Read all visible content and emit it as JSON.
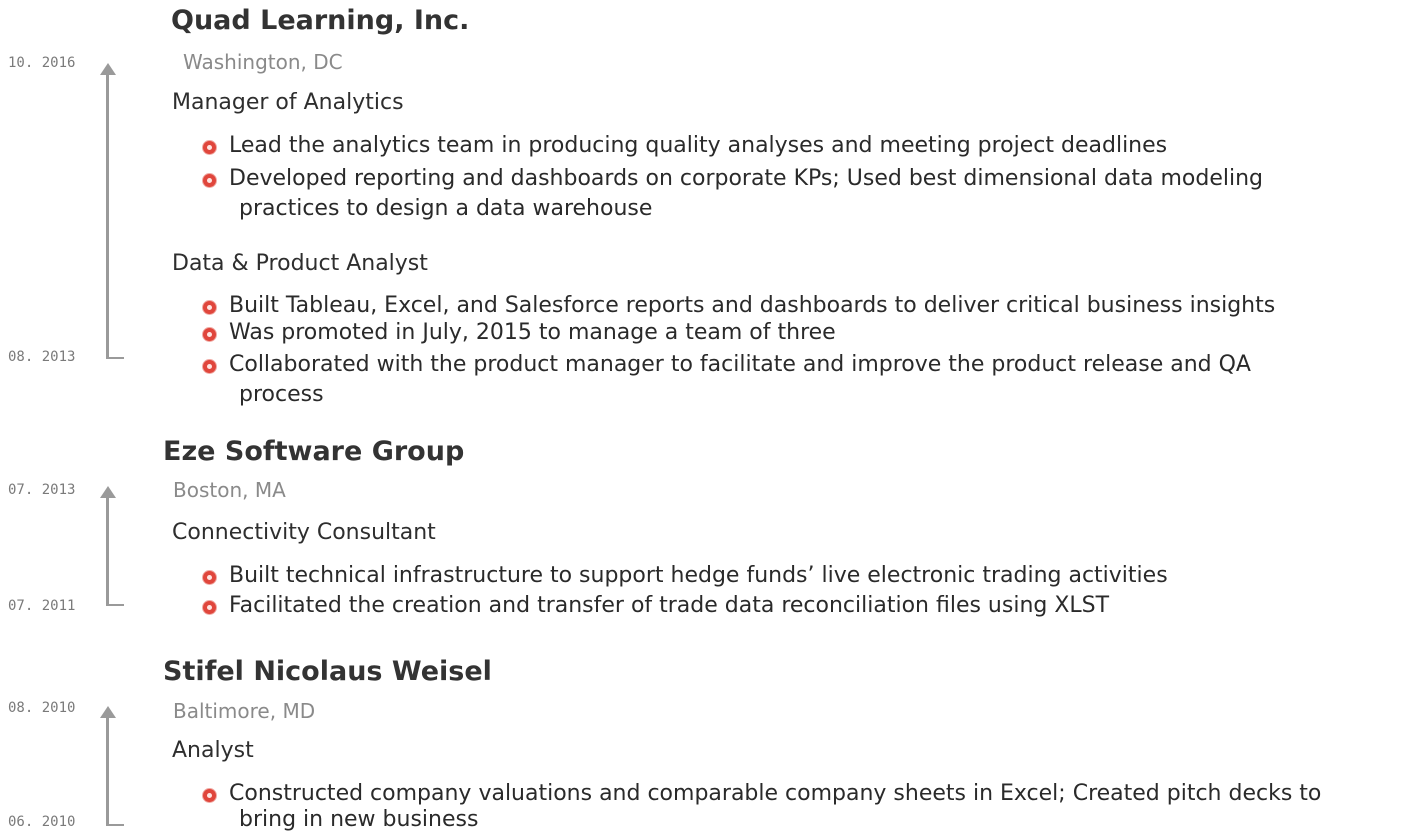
{
  "jobs": [
    {
      "company": "Quad Learning, Inc.",
      "location": "Washington, DC",
      "date_start": "10. 2016",
      "date_end": "08. 2013",
      "roles": [
        {
          "title": "Manager of Analytics",
          "bullets": [
            "Lead the analytics team in producing quality analyses and meeting project deadlines",
            "Developed reporting and dashboards on corporate KPs; Used best dimensional data modeling",
            "practices to design a data warehouse"
          ]
        },
        {
          "title": "Data & Product Analyst",
          "bullets": [
            "Built Tableau, Excel, and Salesforce reports and dashboards to deliver critical business insights",
            "Was promoted in July, 2015 to manage a team of three",
            "Collaborated with the product manager to facilitate and improve the product release and QA",
            "process"
          ]
        }
      ]
    },
    {
      "company": "Eze Software Group",
      "location": "Boston, MA",
      "date_start": "07. 2013",
      "date_end": "07. 2011",
      "roles": [
        {
          "title": "Connectivity Consultant",
          "bullets": [
            "Built technical infrastructure to support hedge funds’ live electronic trading activities",
            "Facilitated the creation and transfer of trade data reconciliation files using XLST"
          ]
        }
      ]
    },
    {
      "company": "Stifel Nicolaus Weisel",
      "location": "Baltimore, MD",
      "date_start": "08. 2010",
      "date_end": "06. 2010",
      "roles": [
        {
          "title": "Analyst",
          "bullets": [
            "Constructed company valuations and comparable company sheets in Excel; Created pitch decks to",
            "bring in new business"
          ]
        }
      ]
    }
  ],
  "colors": {
    "bullet": "#e0463c",
    "timeline": "#9a9a9a"
  }
}
